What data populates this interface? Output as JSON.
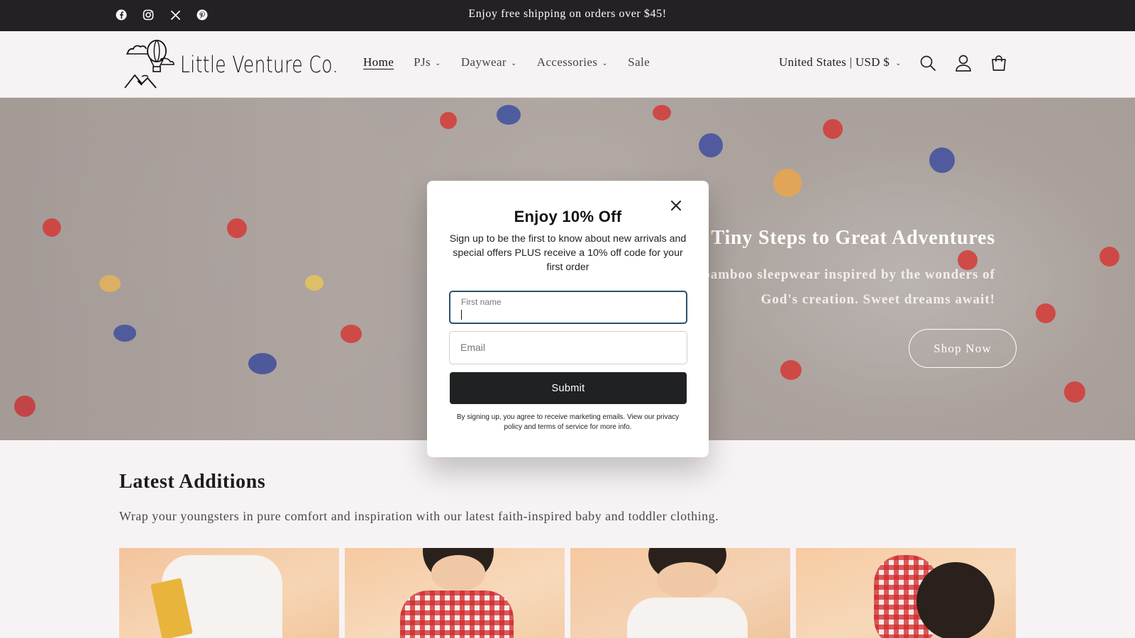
{
  "announcement": {
    "text": "Enjoy free shipping on orders over $45!",
    "social_icons": [
      "facebook-icon",
      "instagram-icon",
      "x-icon",
      "pinterest-icon"
    ]
  },
  "header": {
    "logo_text": "Little Venture Co.",
    "nav": [
      {
        "label": "Home",
        "active": true,
        "dropdown": false
      },
      {
        "label": "PJs",
        "active": false,
        "dropdown": true
      },
      {
        "label": "Daywear",
        "active": false,
        "dropdown": true
      },
      {
        "label": "Accessories",
        "active": false,
        "dropdown": true
      },
      {
        "label": "Sale",
        "active": false,
        "dropdown": false
      }
    ],
    "locale": "United States | USD $",
    "icons": [
      "search-icon",
      "account-icon",
      "cart-icon"
    ]
  },
  "hero": {
    "title": "m Tiny Steps to Great Adventures",
    "subtitle": "zy bamboo sleepwear inspired by the wonders of God's creation. Sweet dreams await!",
    "cta": "Shop Now"
  },
  "latest": {
    "title": "Latest Additions",
    "subtitle": "Wrap your youngsters in pure comfort and inspiration with our latest faith-inspired baby and toddler clothing."
  },
  "modal": {
    "title": "Enjoy 10% Off",
    "description": "Sign up to be the first to know about new arrivals and special offers PLUS receive a 10% off code for your first order",
    "first_name_label": "First name",
    "first_name_value": "",
    "email_placeholder": "Email",
    "submit_label": "Submit",
    "legal": "By signing up, you agree to receive marketing emails. View our privacy policy and terms of service for more info."
  },
  "colors": {
    "announcement_bg": "#232126",
    "page_bg": "#f7f3f5",
    "button_dark": "#1f2123",
    "focus_border": "#2a4f6b"
  }
}
